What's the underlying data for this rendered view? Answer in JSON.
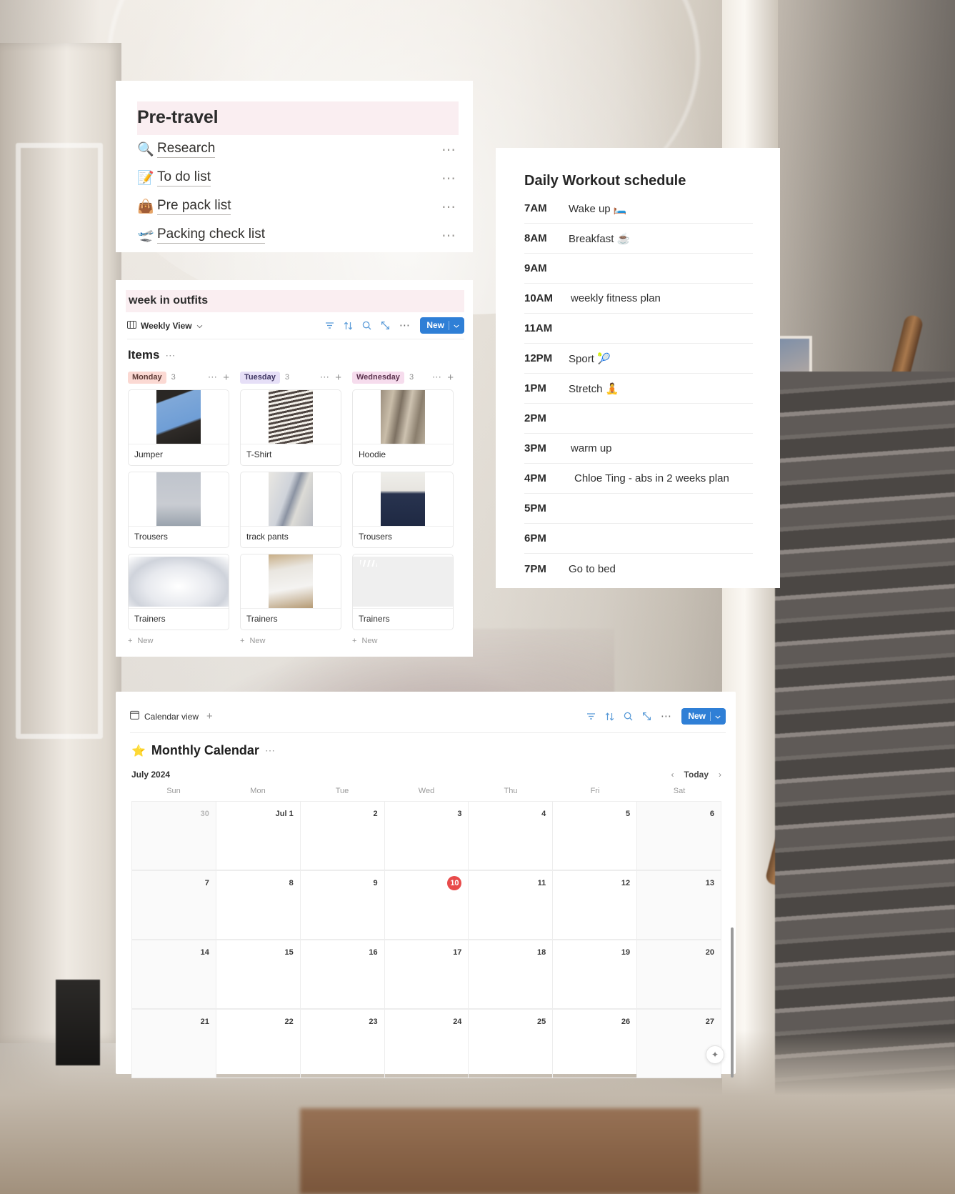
{
  "pretravel": {
    "title": "Pre-travel",
    "title_band_color": "#faeef1",
    "rows": [
      {
        "emoji": "🔍",
        "icon": "magnifier-icon",
        "label": "Research",
        "menu": "⋯"
      },
      {
        "emoji": "📝",
        "icon": "memo-icon",
        "label": "To do list",
        "menu": "⋯"
      },
      {
        "emoji": "👜",
        "icon": "handbag-icon",
        "label": "Pre pack list",
        "menu": "⋯"
      },
      {
        "emoji": "🛫",
        "icon": "airplane-departure-icon",
        "label": "Packing check list",
        "menu": "⋯"
      }
    ]
  },
  "workout": {
    "title": "Daily Workout schedule",
    "rows": [
      {
        "time": "7AM",
        "task": "Wake up 🛏️"
      },
      {
        "time": "8AM",
        "task": "Breakfast ☕"
      },
      {
        "time": "9AM",
        "task": ""
      },
      {
        "time": "10AM",
        "task": "weekly fitness plan"
      },
      {
        "time": "11AM",
        "task": ""
      },
      {
        "time": "12PM",
        "task": "Sport 🎾"
      },
      {
        "time": "1PM",
        "task": "Stretch 🧘"
      },
      {
        "time": "2PM",
        "task": ""
      },
      {
        "time": "3PM",
        "task": "warm up"
      },
      {
        "time": "4PM",
        "task": "Chloe Ting - abs in 2 weeks plan"
      },
      {
        "time": "5PM",
        "task": ""
      },
      {
        "time": "6PM",
        "task": ""
      },
      {
        "time": "7PM",
        "task": "Go to bed"
      }
    ]
  },
  "outfits": {
    "title": "week in outfits",
    "view_label": "Weekly View",
    "view_icon": "board-view-icon",
    "chevron": "⌄",
    "tools": [
      "filter-icon",
      "sort-icon",
      "search-icon",
      "expand-icon",
      "more-icon"
    ],
    "new_button": "New",
    "group_title": "Items",
    "group_menu": "⋯",
    "columns": [
      {
        "day": "Monday",
        "count": "3",
        "chip_bg": "#fbd9d3",
        "chip_fg": "#5d3b36",
        "menu": "⋯",
        "add": "+",
        "new_label": "New",
        "cards": [
          {
            "name": "Jumper",
            "thumb": "img-jumper"
          },
          {
            "name": "Trousers",
            "thumb": "img-trousers"
          },
          {
            "name": "Trainers",
            "thumb": "img-asics"
          }
        ]
      },
      {
        "day": "Tuesday",
        "count": "3",
        "chip_bg": "#e6dff7",
        "chip_fg": "#3f3663",
        "menu": "⋯",
        "add": "+",
        "new_label": "New",
        "cards": [
          {
            "name": "T-Shirt",
            "thumb": "img-tshirt"
          },
          {
            "name": "track pants",
            "thumb": "img-track"
          },
          {
            "name": "Trainers",
            "thumb": "img-nb"
          }
        ]
      },
      {
        "day": "Wednesday",
        "count": "3",
        "chip_bg": "#f6dced",
        "chip_fg": "#5d3550",
        "menu": "⋯",
        "add": "+",
        "new_label": "New",
        "cards": [
          {
            "name": "Hoodie",
            "thumb": "img-hoodie"
          },
          {
            "name": "Trousers",
            "thumb": "img-trousers2"
          },
          {
            "name": "Trainers",
            "thumb": "img-samba"
          }
        ]
      }
    ]
  },
  "calendar": {
    "view_label": "Calendar view",
    "view_icon": "calendar-view-icon",
    "add_view": "+",
    "tools": [
      "filter-icon",
      "sort-icon",
      "search-icon",
      "expand-icon",
      "more-icon"
    ],
    "new_button": "New",
    "star": "⭐",
    "title": "Monthly Calendar",
    "title_menu": "⋯",
    "month": "July 2024",
    "prev": "‹",
    "today": "Today",
    "next": "›",
    "dow": [
      "Sun",
      "Mon",
      "Tue",
      "Wed",
      "Thu",
      "Fri",
      "Sat"
    ],
    "today_date": "10",
    "accent_today": "#e84b4b",
    "accent_blue": "#2f7fd6",
    "weeks": [
      [
        {
          "label": "30",
          "muted": true,
          "weekend": true
        },
        {
          "label": "Jul 1",
          "muted": false,
          "weekend": false
        },
        {
          "label": "2",
          "muted": false,
          "weekend": false
        },
        {
          "label": "3",
          "muted": false,
          "weekend": false
        },
        {
          "label": "4",
          "muted": false,
          "weekend": false
        },
        {
          "label": "5",
          "muted": false,
          "weekend": false
        },
        {
          "label": "6",
          "muted": false,
          "weekend": true
        }
      ],
      [
        {
          "label": "7",
          "muted": false,
          "weekend": true
        },
        {
          "label": "8",
          "muted": false,
          "weekend": false
        },
        {
          "label": "9",
          "muted": false,
          "weekend": false
        },
        {
          "label": "10",
          "muted": false,
          "weekend": false,
          "today": true
        },
        {
          "label": "11",
          "muted": false,
          "weekend": false
        },
        {
          "label": "12",
          "muted": false,
          "weekend": false
        },
        {
          "label": "13",
          "muted": false,
          "weekend": true
        }
      ],
      [
        {
          "label": "14",
          "muted": false,
          "weekend": true
        },
        {
          "label": "15",
          "muted": false,
          "weekend": false
        },
        {
          "label": "16",
          "muted": false,
          "weekend": false
        },
        {
          "label": "17",
          "muted": false,
          "weekend": false
        },
        {
          "label": "18",
          "muted": false,
          "weekend": false
        },
        {
          "label": "19",
          "muted": false,
          "weekend": false
        },
        {
          "label": "20",
          "muted": false,
          "weekend": true
        }
      ],
      [
        {
          "label": "21",
          "muted": false,
          "weekend": true
        },
        {
          "label": "22",
          "muted": false,
          "weekend": false
        },
        {
          "label": "23",
          "muted": false,
          "weekend": false
        },
        {
          "label": "24",
          "muted": false,
          "weekend": false
        },
        {
          "label": "25",
          "muted": false,
          "weekend": false
        },
        {
          "label": "26",
          "muted": false,
          "weekend": false
        },
        {
          "label": "27",
          "muted": false,
          "weekend": true
        }
      ]
    ],
    "fab": "✦"
  }
}
